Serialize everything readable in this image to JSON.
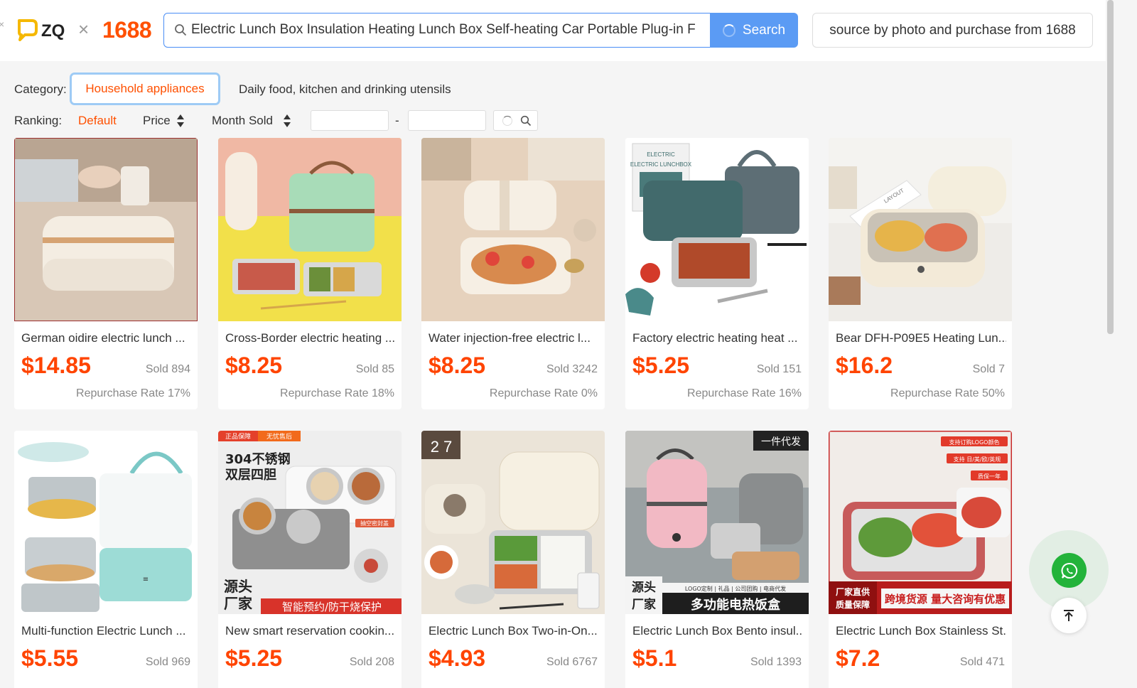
{
  "header": {
    "brand": "ZQ",
    "separator": "×",
    "partner": "1688",
    "close_glyph": "×",
    "search": {
      "value": "Electric Lunch Box Insulation Heating Lunch Box Self-heating Car Portable Plug-in F",
      "button_label": "Search"
    },
    "photo_button_label": "source by photo and purchase from 1688"
  },
  "filters": {
    "category_label": "Category:",
    "categories": [
      "Household appliances",
      "Daily food, kitchen and drinking utensils"
    ],
    "ranking_label": "Ranking:",
    "ranking_options": [
      "Default",
      "Price",
      "Month Sold"
    ],
    "range_separator": "-"
  },
  "products": [
    {
      "title": "German oidire electric lunch ...",
      "price": "$14.85",
      "sold": "Sold 894",
      "repurchase": "Repurchase Rate 17%"
    },
    {
      "title": "Cross-Border electric heating ...",
      "price": "$8.25",
      "sold": "Sold 85",
      "repurchase": "Repurchase Rate 18%"
    },
    {
      "title": "Water injection-free electric l...",
      "price": "$8.25",
      "sold": "Sold 3242",
      "repurchase": "Repurchase Rate 0%"
    },
    {
      "title": "Factory electric heating heat ...",
      "price": "$5.25",
      "sold": "Sold 151",
      "repurchase": "Repurchase Rate 16%"
    },
    {
      "title": "Bear DFH-P09E5 Heating Lun...",
      "price": "$16.2",
      "sold": "Sold 7",
      "repurchase": "Repurchase Rate 50%"
    },
    {
      "title": "Multi-function Electric Lunch ...",
      "price": "$5.55",
      "sold": "Sold 969"
    },
    {
      "title": "New smart reservation cookin...",
      "price": "$5.25",
      "sold": "Sold 208"
    },
    {
      "title": "Electric Lunch Box Two-in-On...",
      "price": "$4.93",
      "sold": "Sold 6767"
    },
    {
      "title": "Electric Lunch Box Bento insul...",
      "price": "$5.1",
      "sold": "Sold 1393"
    },
    {
      "title": "Electric Lunch Box Stainless St...",
      "price": "$7.2",
      "sold": "Sold 471"
    }
  ],
  "image_text": {
    "p4_box": "ELECTRIC LUNCHBOX",
    "p4_box_small": "ELECTRIC",
    "p5_book": "LAYOUT",
    "p7_badge_1": "正品保障",
    "p7_badge_2": "无忧售后",
    "p7_title_1": "304不锈钢",
    "p7_title_2": "双层四胆",
    "p7_tag": "抽空密封盖",
    "p7_source_1": "源头",
    "p7_source_2": "厂家",
    "p7_banner": "智能预约/防干烧保护",
    "p8_calendar": "2 7",
    "p9_badge": "一件代发",
    "p9_source_1": "源头",
    "p9_source_2": "厂家",
    "p9_strip": "LOGO定制 | 礼品 | 公司团购 | 电商代发",
    "p9_banner": "多功能电热饭盒",
    "p10_tag_1": "支持订购LOGO颜色",
    "p10_tag_2": "支持 日/美/欧/英规",
    "p10_tag_3": "质保一年",
    "p10_left_1": "厂家直供",
    "p10_left_2": "质量保障",
    "p10_banner": "跨境货源 量大咨询有优惠"
  },
  "icons": {
    "logo": "zq-logo-icon",
    "search": "search-icon",
    "loading": "loading-spinner-icon",
    "sort": "sort-arrows-icon",
    "whatsapp": "whatsapp-icon",
    "back_to_top": "back-to-top-icon"
  },
  "colors": {
    "accent": "#ff5000",
    "price": "#ff4400",
    "search_button": "#5b9bf4",
    "search_border": "#4a8ef5",
    "whatsapp": "#23b33a",
    "logo_yellow": "#f5b800"
  }
}
